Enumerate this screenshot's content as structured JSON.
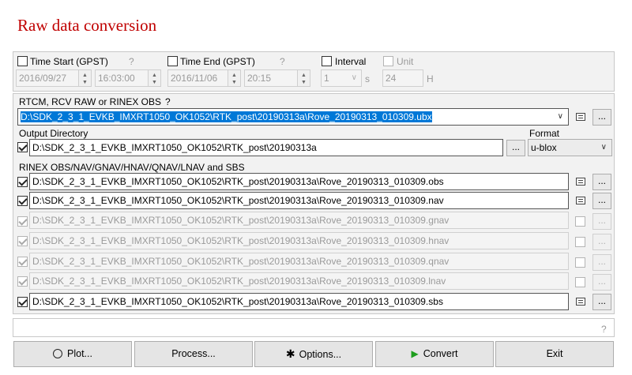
{
  "title": "Raw data conversion",
  "time": {
    "start_label": "Time Start (GPST)",
    "start_help": "?",
    "start_date": "2016/09/27",
    "start_time": "16:03:00",
    "end_label": "Time End (GPST)",
    "end_help": "?",
    "end_date": "2016/11/06",
    "end_time": "20:15",
    "interval_label": "Interval",
    "interval_value": "1",
    "interval_unit": "s",
    "unit_label": "Unit",
    "unit_value": "24",
    "unit_suffix": "H"
  },
  "input": {
    "label": "RTCM, RCV RAW or RINEX OBS",
    "help": "?",
    "value": "D:\\SDK_2_3_1_EVKB_IMXRT1050_OK1052\\RTK_post\\20190313a\\Rove_20190313_010309.ubx",
    "browse": "..."
  },
  "output_dir": {
    "label": "Output Directory",
    "value": "D:\\SDK_2_3_1_EVKB_IMXRT1050_OK1052\\RTK_post\\20190313a",
    "browse": "..."
  },
  "format": {
    "label": "Format",
    "value": "u-blox"
  },
  "rinex": {
    "label": "RINEX OBS/NAV/GNAV/HNAV/QNAV/LNAV and SBS",
    "browse": "...",
    "files": [
      {
        "value": "D:\\SDK_2_3_1_EVKB_IMXRT1050_OK1052\\RTK_post\\20190313a\\Rove_20190313_010309.obs"
      },
      {
        "value": "D:\\SDK_2_3_1_EVKB_IMXRT1050_OK1052\\RTK_post\\20190313a\\Rove_20190313_010309.nav"
      },
      {
        "value": "D:\\SDK_2_3_1_EVKB_IMXRT1050_OK1052\\RTK_post\\20190313a\\Rove_20190313_010309.gnav"
      },
      {
        "value": "D:\\SDK_2_3_1_EVKB_IMXRT1050_OK1052\\RTK_post\\20190313a\\Rove_20190313_010309.hnav"
      },
      {
        "value": "D:\\SDK_2_3_1_EVKB_IMXRT1050_OK1052\\RTK_post\\20190313a\\Rove_20190313_010309.qnav"
      },
      {
        "value": "D:\\SDK_2_3_1_EVKB_IMXRT1050_OK1052\\RTK_post\\20190313a\\Rove_20190313_010309.lnav"
      },
      {
        "value": "D:\\SDK_2_3_1_EVKB_IMXRT1050_OK1052\\RTK_post\\20190313a\\Rove_20190313_010309.sbs"
      }
    ]
  },
  "message": {
    "help": "?"
  },
  "buttons": {
    "plot": "Plot...",
    "process": "Process...",
    "options": "Options...",
    "convert": "Convert",
    "exit": "Exit"
  },
  "colors": {
    "title": "#c00000",
    "selection": "#0078d7",
    "convert_arrow": "#1e9e1e"
  }
}
